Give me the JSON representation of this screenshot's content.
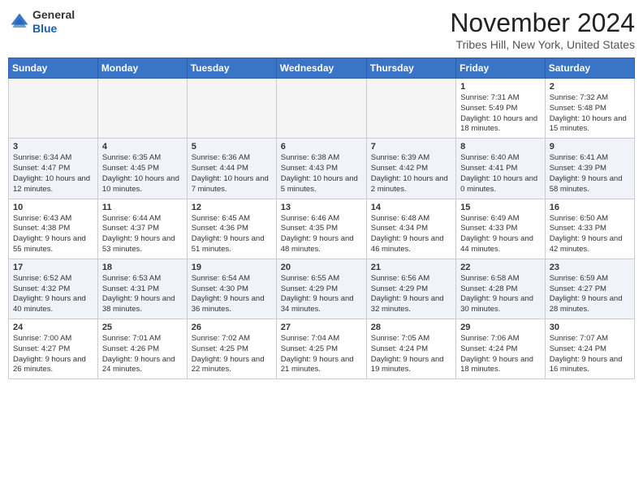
{
  "header": {
    "logo": {
      "general": "General",
      "blue": "Blue"
    },
    "title": "November 2024",
    "location": "Tribes Hill, New York, United States"
  },
  "weekdays": [
    "Sunday",
    "Monday",
    "Tuesday",
    "Wednesday",
    "Thursday",
    "Friday",
    "Saturday"
  ],
  "weeks": [
    [
      {
        "day": "",
        "info": ""
      },
      {
        "day": "",
        "info": ""
      },
      {
        "day": "",
        "info": ""
      },
      {
        "day": "",
        "info": ""
      },
      {
        "day": "",
        "info": ""
      },
      {
        "day": "1",
        "info": "Sunrise: 7:31 AM\nSunset: 5:49 PM\nDaylight: 10 hours and 18 minutes."
      },
      {
        "day": "2",
        "info": "Sunrise: 7:32 AM\nSunset: 5:48 PM\nDaylight: 10 hours and 15 minutes."
      }
    ],
    [
      {
        "day": "3",
        "info": "Sunrise: 6:34 AM\nSunset: 4:47 PM\nDaylight: 10 hours and 12 minutes."
      },
      {
        "day": "4",
        "info": "Sunrise: 6:35 AM\nSunset: 4:45 PM\nDaylight: 10 hours and 10 minutes."
      },
      {
        "day": "5",
        "info": "Sunrise: 6:36 AM\nSunset: 4:44 PM\nDaylight: 10 hours and 7 minutes."
      },
      {
        "day": "6",
        "info": "Sunrise: 6:38 AM\nSunset: 4:43 PM\nDaylight: 10 hours and 5 minutes."
      },
      {
        "day": "7",
        "info": "Sunrise: 6:39 AM\nSunset: 4:42 PM\nDaylight: 10 hours and 2 minutes."
      },
      {
        "day": "8",
        "info": "Sunrise: 6:40 AM\nSunset: 4:41 PM\nDaylight: 10 hours and 0 minutes."
      },
      {
        "day": "9",
        "info": "Sunrise: 6:41 AM\nSunset: 4:39 PM\nDaylight: 9 hours and 58 minutes."
      }
    ],
    [
      {
        "day": "10",
        "info": "Sunrise: 6:43 AM\nSunset: 4:38 PM\nDaylight: 9 hours and 55 minutes."
      },
      {
        "day": "11",
        "info": "Sunrise: 6:44 AM\nSunset: 4:37 PM\nDaylight: 9 hours and 53 minutes."
      },
      {
        "day": "12",
        "info": "Sunrise: 6:45 AM\nSunset: 4:36 PM\nDaylight: 9 hours and 51 minutes."
      },
      {
        "day": "13",
        "info": "Sunrise: 6:46 AM\nSunset: 4:35 PM\nDaylight: 9 hours and 48 minutes."
      },
      {
        "day": "14",
        "info": "Sunrise: 6:48 AM\nSunset: 4:34 PM\nDaylight: 9 hours and 46 minutes."
      },
      {
        "day": "15",
        "info": "Sunrise: 6:49 AM\nSunset: 4:33 PM\nDaylight: 9 hours and 44 minutes."
      },
      {
        "day": "16",
        "info": "Sunrise: 6:50 AM\nSunset: 4:33 PM\nDaylight: 9 hours and 42 minutes."
      }
    ],
    [
      {
        "day": "17",
        "info": "Sunrise: 6:52 AM\nSunset: 4:32 PM\nDaylight: 9 hours and 40 minutes."
      },
      {
        "day": "18",
        "info": "Sunrise: 6:53 AM\nSunset: 4:31 PM\nDaylight: 9 hours and 38 minutes."
      },
      {
        "day": "19",
        "info": "Sunrise: 6:54 AM\nSunset: 4:30 PM\nDaylight: 9 hours and 36 minutes."
      },
      {
        "day": "20",
        "info": "Sunrise: 6:55 AM\nSunset: 4:29 PM\nDaylight: 9 hours and 34 minutes."
      },
      {
        "day": "21",
        "info": "Sunrise: 6:56 AM\nSunset: 4:29 PM\nDaylight: 9 hours and 32 minutes."
      },
      {
        "day": "22",
        "info": "Sunrise: 6:58 AM\nSunset: 4:28 PM\nDaylight: 9 hours and 30 minutes."
      },
      {
        "day": "23",
        "info": "Sunrise: 6:59 AM\nSunset: 4:27 PM\nDaylight: 9 hours and 28 minutes."
      }
    ],
    [
      {
        "day": "24",
        "info": "Sunrise: 7:00 AM\nSunset: 4:27 PM\nDaylight: 9 hours and 26 minutes."
      },
      {
        "day": "25",
        "info": "Sunrise: 7:01 AM\nSunset: 4:26 PM\nDaylight: 9 hours and 24 minutes."
      },
      {
        "day": "26",
        "info": "Sunrise: 7:02 AM\nSunset: 4:25 PM\nDaylight: 9 hours and 22 minutes."
      },
      {
        "day": "27",
        "info": "Sunrise: 7:04 AM\nSunset: 4:25 PM\nDaylight: 9 hours and 21 minutes."
      },
      {
        "day": "28",
        "info": "Sunrise: 7:05 AM\nSunset: 4:24 PM\nDaylight: 9 hours and 19 minutes."
      },
      {
        "day": "29",
        "info": "Sunrise: 7:06 AM\nSunset: 4:24 PM\nDaylight: 9 hours and 18 minutes."
      },
      {
        "day": "30",
        "info": "Sunrise: 7:07 AM\nSunset: 4:24 PM\nDaylight: 9 hours and 16 minutes."
      }
    ]
  ]
}
